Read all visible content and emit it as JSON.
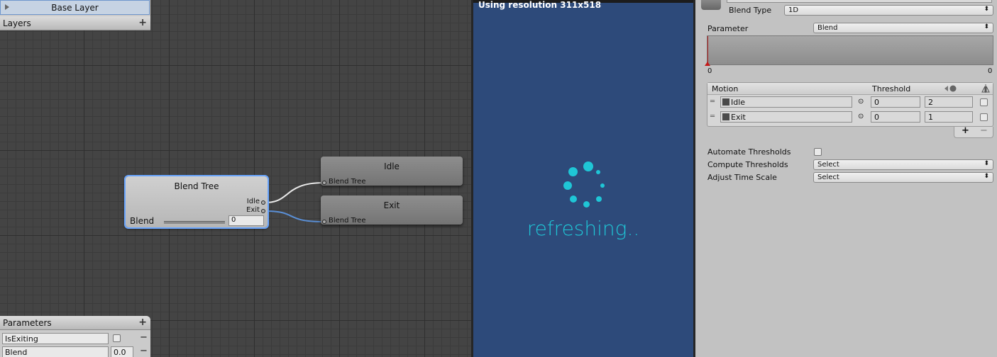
{
  "layers_panel": {
    "base_layer": "Base Layer",
    "header": "Layers",
    "add": "+"
  },
  "graph": {
    "blend_tree_node": {
      "title": "Blend Tree",
      "output_idle": "Idle",
      "output_exit": "Exit",
      "param_label": "Blend",
      "param_value": "0"
    },
    "idle_node": {
      "title": "Idle",
      "input": "Blend Tree"
    },
    "exit_node": {
      "title": "Exit",
      "input": "Blend Tree"
    }
  },
  "parameters_panel": {
    "header": "Parameters",
    "add": "+",
    "params": [
      {
        "name": "IsExiting",
        "value_type": "bool",
        "remove": "−"
      },
      {
        "name": "Blend",
        "value": "0.0",
        "remove": "−"
      }
    ]
  },
  "game_view": {
    "resolution_text": "Using resolution 311x518",
    "loading_text": "refreshing..",
    "accent": "#1fc6d6",
    "background": "#2d4a7a"
  },
  "inspector": {
    "blend_type_label": "Blend Type",
    "blend_type_value": "1D",
    "parameter_label": "Parameter",
    "parameter_value": "Blend",
    "graph_min": "0",
    "graph_max": "0",
    "motion_header": "Motion",
    "threshold_header": "Threshold",
    "motions": [
      {
        "name": "Idle",
        "threshold": "0",
        "time_scale": "2"
      },
      {
        "name": "Exit",
        "threshold": "0",
        "time_scale": "1"
      }
    ],
    "add": "+",
    "remove": "−",
    "automate_label": "Automate Thresholds",
    "compute_label": "Compute Thresholds",
    "compute_value": "Select",
    "adjust_label": "Adjust Time Scale",
    "adjust_value": "Select"
  }
}
